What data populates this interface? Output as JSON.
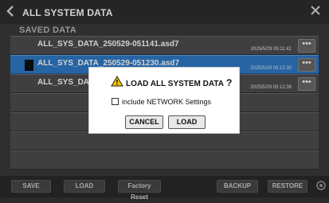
{
  "window": {
    "title": "ALL SYSTEM DATA"
  },
  "section": {
    "label": "SAVED DATA"
  },
  "files": [
    {
      "name": "ALL_SYS_DATA_250529-051141.asd7",
      "date": "2025/5/29 05:11:41",
      "more": "•••",
      "selected": false
    },
    {
      "name": "ALL_SYS_DATA_250529-051230.asd7",
      "date": "2025/5/29 05:12:30",
      "more": "•••",
      "selected": true
    },
    {
      "name": "ALL_SYS_DATA_250529-051236.asd7",
      "date": "2025/5/29 05:12:36",
      "more": "•••",
      "selected": false
    },
    {
      "name": "",
      "date": "",
      "more": "",
      "selected": false
    },
    {
      "name": "",
      "date": "",
      "more": "",
      "selected": false
    },
    {
      "name": "",
      "date": "",
      "more": "",
      "selected": false
    },
    {
      "name": "",
      "date": "",
      "more": "",
      "selected": false
    }
  ],
  "footer": {
    "save": "SAVE",
    "load": "LOAD",
    "factory_reset": "Factory Reset",
    "backup": "BACKUP",
    "restore": "RESTORE"
  },
  "dialog": {
    "title": "LOAD ALL SYSTEM DATA",
    "question_mark": "?",
    "checkbox_label": "include NETWORK Settings",
    "checkbox_checked": false,
    "cancel": "CANCEL",
    "load": "LOAD"
  },
  "colors": {
    "selected_row": "#2f7ac8",
    "row": "#4e4e4e",
    "warning": "#f2c200"
  }
}
